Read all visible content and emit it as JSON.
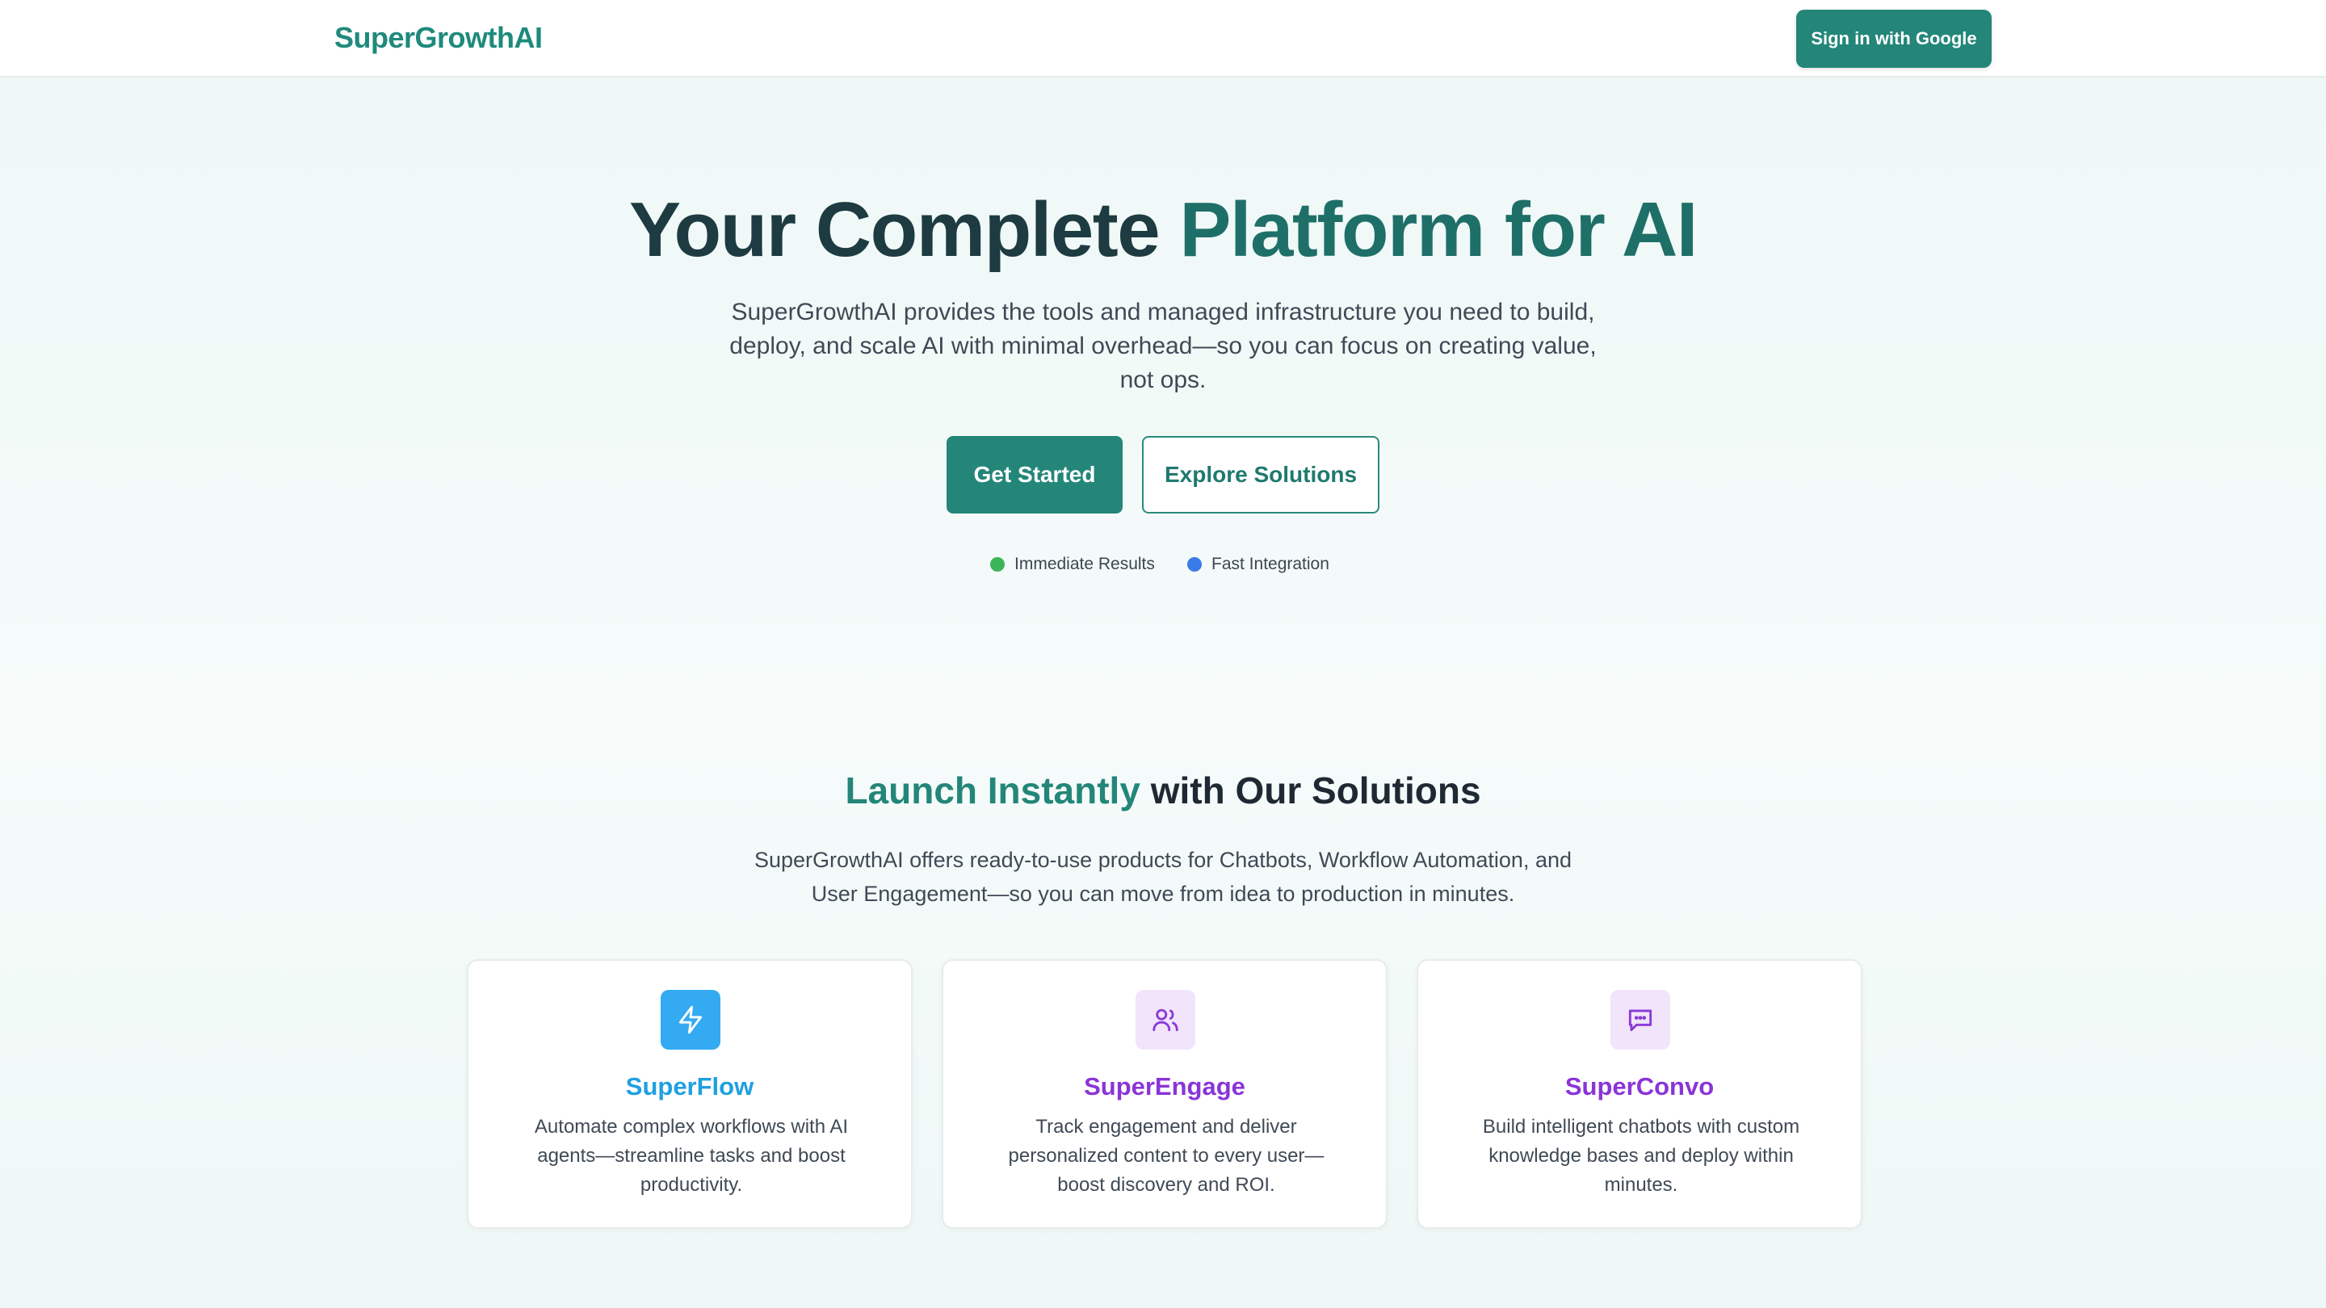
{
  "nav": {
    "logo": "SuperGrowthAI",
    "signin_label": "Sign in with Google"
  },
  "hero": {
    "title_part1": "Your Complete ",
    "title_part2": "Platform for AI",
    "subtitle": "SuperGrowthAI provides the tools and managed infrastructure you need to build, deploy, and scale AI with minimal overhead—so you can focus on creating value, not ops.",
    "primary_label": "Get Started",
    "secondary_label": "Explore Solutions",
    "badges": [
      {
        "label": "Immediate Results",
        "color": "#3cb55a"
      },
      {
        "label": "Fast Integration",
        "color": "#3b7be8"
      }
    ]
  },
  "solutions": {
    "title_accent": "Launch Instantly",
    "title_rest": " with Our Solutions",
    "subtitle": "SuperGrowthAI offers ready-to-use products for Chatbots, Workflow Automation, and User Engagement—so you can move from idea to production in minutes.",
    "cards": [
      {
        "title": "SuperFlow",
        "description": "Automate complex workflows with AI agents—streamline tasks and boost productivity.",
        "icon": "lightning-icon",
        "title_color": "#1fa0e0",
        "icon_bg": "#33aaf2",
        "icon_color": "#ffffff"
      },
      {
        "title": "SuperEngage",
        "description": "Track engagement and deliver personalized content to every user—boost discovery and ROI.",
        "icon": "users-icon",
        "title_color": "#8a34d8",
        "icon_bg": "#f1e4fb",
        "icon_color": "#8a3ad6"
      },
      {
        "title": "SuperConvo",
        "description": "Build intelligent chatbots with custom knowledge bases and deploy within minutes.",
        "icon": "chat-icon",
        "title_color": "#8a34d8",
        "icon_bg": "#f1e4fb",
        "icon_color": "#8a3ad6"
      }
    ]
  },
  "colors": {
    "brand": "#238679",
    "heading_dark": "#1d3b40"
  }
}
